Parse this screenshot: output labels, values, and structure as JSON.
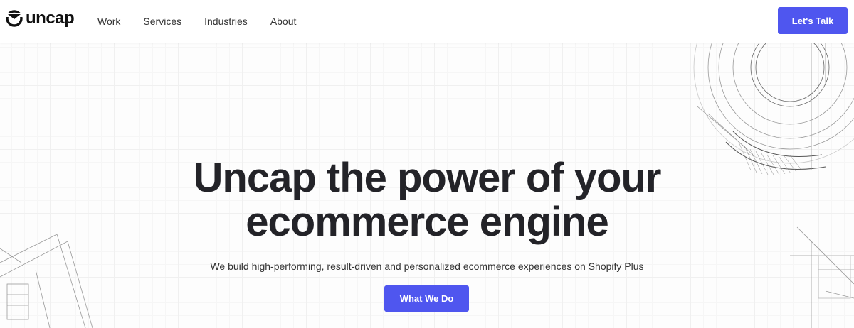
{
  "brand": {
    "name": "uncap",
    "accent_color": "#4f56ef",
    "logo_icon": "uncap-logo-icon"
  },
  "nav": {
    "items": [
      {
        "label": "Work"
      },
      {
        "label": "Services"
      },
      {
        "label": "Industries"
      },
      {
        "label": "About"
      }
    ],
    "cta_label": "Let's Talk"
  },
  "hero": {
    "headline_line1": "Uncap the power of your",
    "headline_line2": "ecommerce engine",
    "subheadline": "We build high-performing, result-driven and personalized ecommerce experiences on Shopify Plus",
    "cta_label": "What We Do"
  }
}
